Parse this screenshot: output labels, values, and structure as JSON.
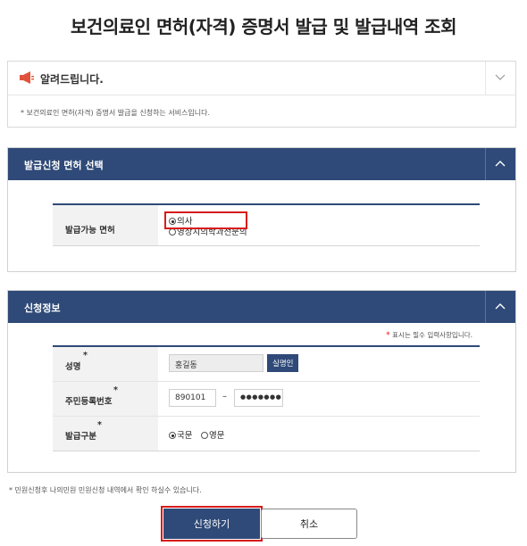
{
  "page": {
    "title": "보건의료인 면허(자격) 증명서 발급 및 발급내역 조회"
  },
  "notice": {
    "icon": "megaphone-icon",
    "title": "알려드립니다.",
    "body": "* 보건의료인 면허(자격) 증명서 발급을 신청하는 서비스입니다."
  },
  "license_section": {
    "title": "발급신청 면허 선택",
    "row_label": "발급가능 면허",
    "options": [
      {
        "label": "의사",
        "selected": true
      },
      {
        "label": "영상치의학과전문의",
        "selected": false
      }
    ]
  },
  "info_section": {
    "title": "신청정보",
    "required_note": "표시는 필수 입력사항입니다.",
    "name": {
      "label": "성명",
      "value": "홍길동",
      "verify_button": "실명인"
    },
    "rrn": {
      "label": "주민등록번호",
      "front": "890101",
      "dash": "–",
      "back": "●●●●●●●"
    },
    "issue_type": {
      "label": "발급구분",
      "options": [
        {
          "label": "국문",
          "selected": true
        },
        {
          "label": "영문",
          "selected": false
        }
      ]
    }
  },
  "footer_note": "* 민원신청후 나의민원 민원신청 내역에서 확인 하실수 있습니다.",
  "buttons": {
    "submit": "신청하기",
    "cancel": "취소"
  },
  "colors": {
    "accent": "#2f4a78",
    "highlight": "#d81b1b",
    "required": "#ee1111"
  }
}
